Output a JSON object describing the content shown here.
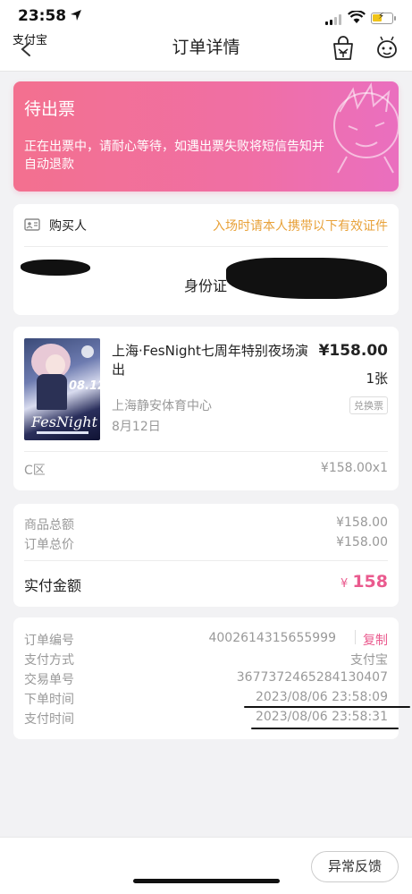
{
  "status_bar": {
    "time": "23:58"
  },
  "nav": {
    "back_app": "支付宝",
    "title": "订单详情"
  },
  "banner": {
    "title": "待出票",
    "message": "正在出票中，请耐心等待，如遇出票失败将短信告知并自动退款"
  },
  "buyer": {
    "label": "购买人",
    "note": "入场时请本人携带以下有效证件",
    "id_type": "身份证"
  },
  "ticket": {
    "poster": {
      "date": "08.12",
      "title": "FesNight"
    },
    "name": "上海·FesNight七周年特别夜场演出",
    "price": "¥158.00",
    "quantity": "1张",
    "venue": "上海静安体育中心",
    "badge": "兑换票",
    "date": "8月12日",
    "zone": "C区",
    "zone_price": "¥158.00x1"
  },
  "summary": {
    "goods_total_label": "商品总额",
    "goods_total": "¥158.00",
    "order_total_label": "订单总价",
    "order_total": "¥158.00",
    "paid_label": "实付金额",
    "paid_currency": "¥",
    "paid_amount": "158"
  },
  "order_info": {
    "order_no_label": "订单编号",
    "order_no": "4002614315655999",
    "copy_label": "复制",
    "pay_method_label": "支付方式",
    "pay_method": "支付宝",
    "trade_no_label": "交易单号",
    "trade_no": "3677372465284130407",
    "order_time_label": "下单时间",
    "order_time": "2023/08/06 23:58:09",
    "pay_time_label": "支付时间",
    "pay_time": "2023/08/06 23:58:31"
  },
  "bottom": {
    "feedback_label": "异常反馈"
  },
  "colors": {
    "accent_pink": "#ea5a8e",
    "warning_orange": "#e8a23a",
    "banner_start": "#f3708f",
    "banner_end": "#ea6fbf"
  }
}
